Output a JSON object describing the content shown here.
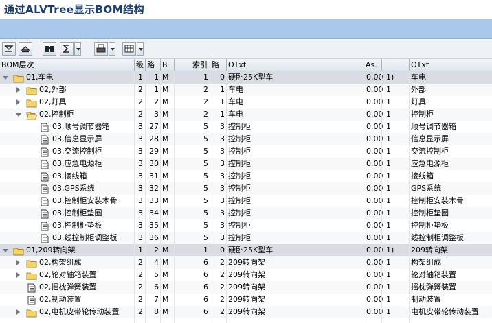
{
  "page": {
    "title": "通过ALVTree显示BOM结构"
  },
  "toolbar": {
    "buttons": [
      {
        "name": "expand-all-button",
        "icon": "expand-icon"
      },
      {
        "name": "collapse-all-button",
        "icon": "collapse-icon"
      },
      {
        "name": "find-button",
        "icon": "binoculars-icon"
      },
      {
        "name": "sum-button",
        "icon": "sigma-icon"
      },
      {
        "name": "print-button",
        "icon": "printer-icon"
      },
      {
        "name": "layout-button",
        "icon": "layout-icon"
      }
    ]
  },
  "table": {
    "columns": [
      "BOM层次",
      "级",
      "路",
      "B",
      "索引",
      "路",
      "OTxt",
      "As.",
      "",
      "OTxt"
    ],
    "rows": [
      {
        "level": 0,
        "node": "open",
        "icon": "folder",
        "label": "01,车电",
        "lvl": "1",
        "route": "1",
        "b": "M",
        "idx": "1",
        "route2": "0",
        "otxt": "硬卧25K型车",
        "as": "0.00",
        "flag": "1)",
        "otxt2": "车电",
        "hl": true
      },
      {
        "level": 1,
        "node": "closed",
        "icon": "folder",
        "label": "02,外部",
        "lvl": "2",
        "route": "1",
        "b": "M",
        "idx": "2",
        "route2": "1",
        "otxt": "车电",
        "as": "0.00",
        "flag": "1",
        "otxt2": "外部"
      },
      {
        "level": 1,
        "node": "closed",
        "icon": "folder",
        "label": "02,灯具",
        "lvl": "2",
        "route": "2",
        "b": "M",
        "idx": "2",
        "route2": "1",
        "otxt": "车电",
        "as": "0.00",
        "flag": "1",
        "otxt2": "灯具"
      },
      {
        "level": 1,
        "node": "open",
        "icon": "folder-open",
        "label": "02,控制柜",
        "lvl": "2",
        "route": "3",
        "b": "M",
        "idx": "2",
        "route2": "1",
        "otxt": "车电",
        "as": "0.00",
        "flag": "1",
        "otxt2": "控制柜"
      },
      {
        "level": 2,
        "node": "none",
        "icon": "doc",
        "label": "03,顺号调节器箱",
        "lvl": "3",
        "route": "27",
        "b": "M",
        "idx": "5",
        "route2": "3",
        "otxt": "控制柜",
        "as": "0.00",
        "flag": "1",
        "otxt2": "顺号调节器箱"
      },
      {
        "level": 2,
        "node": "none",
        "icon": "doc",
        "label": "03,信息显示屏",
        "lvl": "3",
        "route": "28",
        "b": "M",
        "idx": "5",
        "route2": "3",
        "otxt": "控制柜",
        "as": "0.00",
        "flag": "1",
        "otxt2": "信息显示屏"
      },
      {
        "level": 2,
        "node": "none",
        "icon": "doc",
        "label": "03,交流控制柜",
        "lvl": "3",
        "route": "29",
        "b": "M",
        "idx": "5",
        "route2": "3",
        "otxt": "控制柜",
        "as": "0.00",
        "flag": "1",
        "otxt2": "交流控制柜"
      },
      {
        "level": 2,
        "node": "none",
        "icon": "doc",
        "label": "03,应急电源柜",
        "lvl": "3",
        "route": "30",
        "b": "M",
        "idx": "5",
        "route2": "3",
        "otxt": "控制柜",
        "as": "0.00",
        "flag": "1",
        "otxt2": "应急电源柜"
      },
      {
        "level": 2,
        "node": "none",
        "icon": "doc",
        "label": "03,接线箱",
        "lvl": "3",
        "route": "31",
        "b": "M",
        "idx": "5",
        "route2": "3",
        "otxt": "控制柜",
        "as": "0.00",
        "flag": "1",
        "otxt2": "接线箱"
      },
      {
        "level": 2,
        "node": "none",
        "icon": "doc",
        "label": "03,GPS系统",
        "lvl": "3",
        "route": "32",
        "b": "M",
        "idx": "5",
        "route2": "3",
        "otxt": "控制柜",
        "as": "0.00",
        "flag": "1",
        "otxt2": "GPS系统"
      },
      {
        "level": 2,
        "node": "none",
        "icon": "doc",
        "label": "03,控制柜安装木骨",
        "lvl": "3",
        "route": "33",
        "b": "M",
        "idx": "5",
        "route2": "3",
        "otxt": "控制柜",
        "as": "0.00",
        "flag": "1",
        "otxt2": "控制柜安装木骨"
      },
      {
        "level": 2,
        "node": "none",
        "icon": "doc",
        "label": "03,控制柜垫圈",
        "lvl": "3",
        "route": "34",
        "b": "M",
        "idx": "5",
        "route2": "3",
        "otxt": "控制柜",
        "as": "0.00",
        "flag": "1",
        "otxt2": "控制柜垫圈"
      },
      {
        "level": 2,
        "node": "none",
        "icon": "doc",
        "label": "03,控制柜垫板",
        "lvl": "3",
        "route": "35",
        "b": "M",
        "idx": "5",
        "route2": "3",
        "otxt": "控制柜",
        "as": "0.00",
        "flag": "1",
        "otxt2": "控制柜垫板"
      },
      {
        "level": 2,
        "node": "none",
        "icon": "doc",
        "label": "03,线控制柜调整板",
        "lvl": "3",
        "route": "36",
        "b": "M",
        "idx": "5",
        "route2": "3",
        "otxt": "控制柜",
        "as": "0.00",
        "flag": "1",
        "otxt2": "线控制柜调整板"
      },
      {
        "level": 0,
        "node": "open",
        "icon": "folder",
        "label": "01,209转向架",
        "lvl": "1",
        "route": "2",
        "b": "M",
        "idx": "1",
        "route2": "0",
        "otxt": "硬卧25K型车",
        "as": "0.00",
        "flag": "1)",
        "otxt2": "209转向架",
        "hl": true
      },
      {
        "level": 1,
        "node": "closed",
        "icon": "folder",
        "label": "02,构架组成",
        "lvl": "2",
        "route": "4",
        "b": "M",
        "idx": "6",
        "route2": "2",
        "otxt": "209转向架",
        "as": "0.00",
        "flag": "1",
        "otxt2": "构架组成"
      },
      {
        "level": 1,
        "node": "closed",
        "icon": "folder",
        "label": "02,轮对轴箱装置",
        "lvl": "2",
        "route": "5",
        "b": "M",
        "idx": "6",
        "route2": "2",
        "otxt": "209转向架",
        "as": "0.00",
        "flag": "1",
        "otxt2": "轮对轴箱装置"
      },
      {
        "level": 1,
        "node": "none",
        "icon": "doc",
        "label": "02,摇枕弹簧装置",
        "lvl": "2",
        "route": "6",
        "b": "M",
        "idx": "6",
        "route2": "2",
        "otxt": "209转向架",
        "as": "0.00",
        "flag": "1",
        "otxt2": "摇枕弹簧装置"
      },
      {
        "level": 1,
        "node": "none",
        "icon": "doc",
        "label": "02,制动装置",
        "lvl": "2",
        "route": "7",
        "b": "M",
        "idx": "6",
        "route2": "2",
        "otxt": "209转向架",
        "as": "0.00",
        "flag": "1",
        "otxt2": "制动装置"
      },
      {
        "level": 1,
        "node": "closed",
        "icon": "folder",
        "label": "02,电机皮带轮传动装置",
        "lvl": "2",
        "route": "8",
        "b": "M",
        "idx": "6",
        "route2": "2",
        "otxt": "209转向架",
        "as": "0.00",
        "flag": "1",
        "otxt2": "电机皮带轮传动装置"
      }
    ]
  }
}
